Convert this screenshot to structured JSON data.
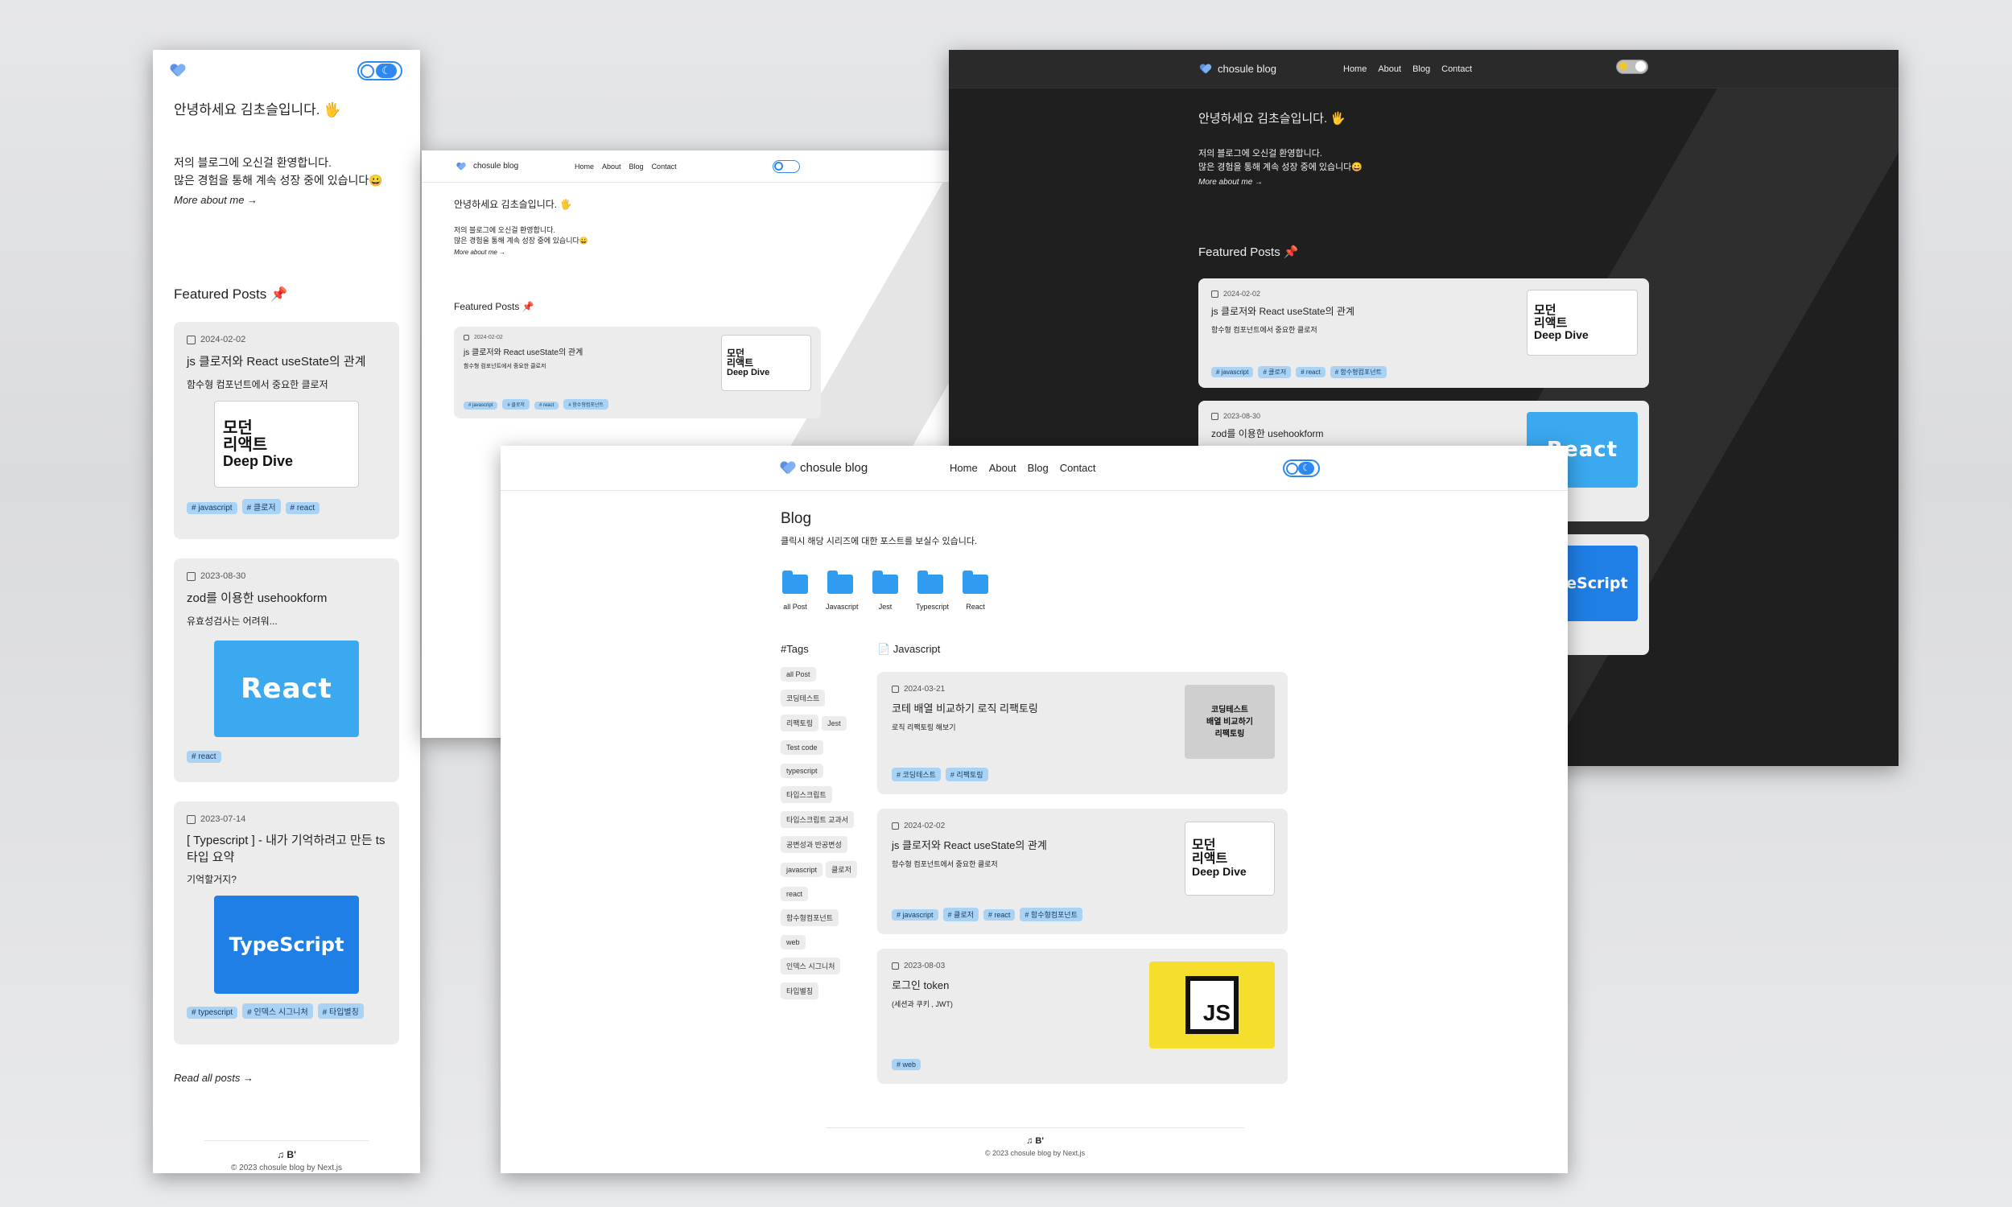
{
  "brand": "chosule blog",
  "nav": [
    "Home",
    "About",
    "Blog",
    "Contact"
  ],
  "hero": {
    "greeting": "안녕하세요 김초슬입니다. 🖐",
    "line1": "저의 블로그에 오신걸 환영합니다.",
    "line2": "많은 경험을 통해 계속 성장 중에 있습니다😀",
    "more": "More about me →"
  },
  "featured_title": "Featured Posts 📌",
  "read_all": "Read all posts →",
  "footer": {
    "logo": "♫ B'",
    "copyright": "© 2023 chosule blog by Next.js"
  },
  "book_text": {
    "l1": "모던",
    "l2": "리액트",
    "l3": "Deep Dive"
  },
  "react_text": "React",
  "ts_text": "TypeScript",
  "featured_posts": [
    {
      "date": "2024-02-02",
      "title": "js 클로저와 React useState의 관계",
      "desc": "함수형 컴포넌트에서 중요한 클로저",
      "tags": [
        "# javascript",
        "# 클로저",
        "# react",
        "# 함수형컴포넌트"
      ]
    },
    {
      "date": "2023-08-30",
      "title": "zod를 이용한 usehookform",
      "desc": "유효성검사는 어려워...",
      "tags": [
        "# react"
      ]
    },
    {
      "date": "2023-07-14",
      "title": "[ Typescript ] - 내가 기억하려고 만든 ts 타입 요약",
      "desc": "기억할거지?",
      "tags": [
        "# typescript",
        "# 인덱스 시그니처",
        "# 타입별칭"
      ]
    }
  ],
  "blog_page": {
    "title": "Blog",
    "subtitle": "클릭시 해당 시리즈에 대한 포스트를 보실수 있습니다.",
    "folders": [
      "all Post",
      "Javascript",
      "Jest",
      "Typescript",
      "React"
    ],
    "tags_title": "#Tags",
    "tags": [
      "all Post",
      "코딩테스트",
      "리팩토링",
      "Jest",
      "Test code",
      "typescript",
      "타입스크립트",
      "타입스크립트 교과서",
      "공변성과 반공변성",
      "javascript",
      "클로저",
      "react",
      "함수형컴포넌트",
      "web",
      "인덱스 시그니처",
      "타입별칭"
    ],
    "section": "📄 Javascript",
    "coding_thumb": "코딩테스트\n배열 비교하기\n리팩토링",
    "js_thumb": "JS",
    "posts": [
      {
        "date": "2024-03-21",
        "title": "코테 배열 비교하기 로직 리팩토링",
        "desc": "로직 리팩토링 해보기",
        "tags": [
          "# 코딩테스트",
          "# 리팩토링"
        ]
      },
      {
        "date": "2024-02-02",
        "title": "js 클로저와 React useState의 관계",
        "desc": "함수형 컴포넌트에서 중요한 클로저",
        "tags": [
          "# javascript",
          "# 클로저",
          "# react",
          "# 함수형컴포넌트"
        ]
      },
      {
        "date": "2023-08-03",
        "title": "로그인 token",
        "desc": "(세션과 쿠키 , JWT)",
        "tags": [
          "# web"
        ]
      }
    ]
  }
}
